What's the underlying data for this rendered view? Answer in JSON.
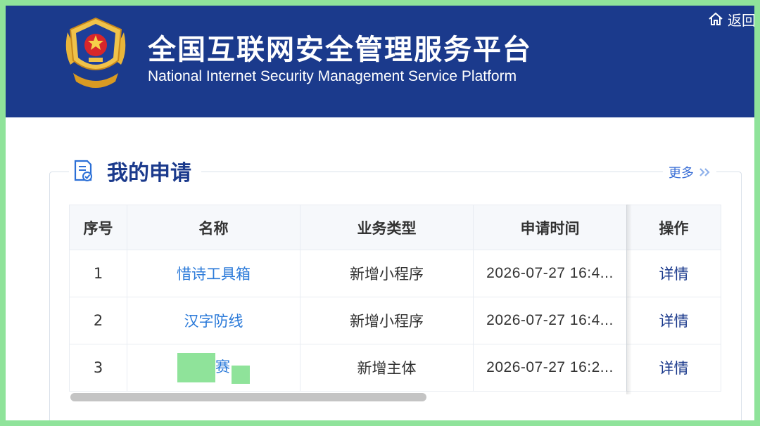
{
  "header": {
    "title_cn": "全国互联网安全管理服务平台",
    "title_en": "National Internet Security Management Service Platform",
    "home_label": "返回",
    "emblem_icon": "police-emblem-icon",
    "bg_color": "#1b3a8c"
  },
  "section": {
    "title": "我的申请",
    "more_label": "更多",
    "icon": "document-check-icon"
  },
  "table": {
    "headers": [
      "序号",
      "名称",
      "业务类型",
      "申请时间",
      "操作"
    ],
    "rows": [
      {
        "index": "1",
        "name": "惜诗工具箱",
        "type": "新增小程序",
        "time": "2026-07-27 16:4...",
        "action": "详情"
      },
      {
        "index": "2",
        "name": "汉字防线",
        "type": "新增小程序",
        "time": "2026-07-27 16:4...",
        "action": "详情"
      },
      {
        "index": "3",
        "name": "赛",
        "type": "新增主体",
        "time": "2026-07-27 16:2...",
        "action": "详情"
      }
    ]
  },
  "colors": {
    "accent": "#1b3a8c",
    "link": "#2b7ad9",
    "redaction": "#8fe39a"
  }
}
